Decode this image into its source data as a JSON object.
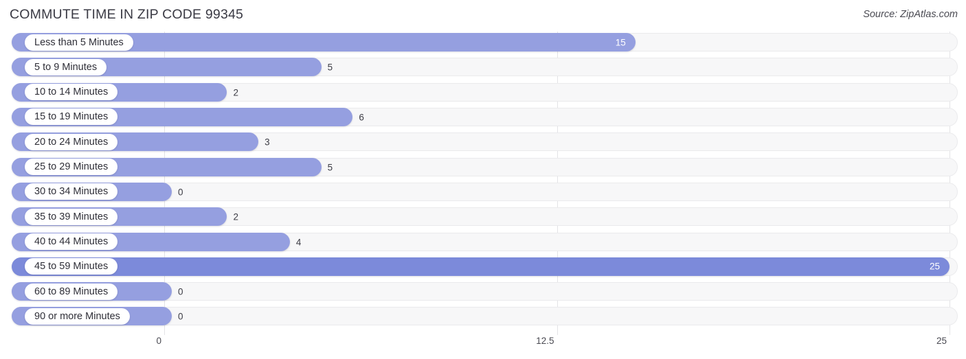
{
  "header": {
    "title": "COMMUTE TIME IN ZIP CODE 99345",
    "source": "Source: ZipAtlas.com"
  },
  "chart_data": {
    "type": "bar",
    "orientation": "horizontal",
    "title": "COMMUTE TIME IN ZIP CODE 99345",
    "xlabel": "",
    "ylabel": "",
    "xlim": [
      0,
      25
    ],
    "grid": true,
    "legend": false,
    "source": "Source: ZipAtlas.com",
    "tick_labels": [
      "0",
      "12.5",
      "25"
    ],
    "tick_values": [
      0,
      12.5,
      25
    ],
    "categories": [
      "Less than 5 Minutes",
      "5 to 9 Minutes",
      "10 to 14 Minutes",
      "15 to 19 Minutes",
      "20 to 24 Minutes",
      "25 to 29 Minutes",
      "30 to 34 Minutes",
      "35 to 39 Minutes",
      "40 to 44 Minutes",
      "45 to 59 Minutes",
      "60 to 89 Minutes",
      "90 or more Minutes"
    ],
    "values": [
      15,
      5,
      2,
      6,
      3,
      5,
      0,
      2,
      4,
      25,
      0,
      0
    ],
    "value_labels": [
      "15",
      "5",
      "2",
      "6",
      "3",
      "5",
      "0",
      "2",
      "4",
      "25",
      "0",
      "0"
    ],
    "colors": {
      "bar": "#959fe0",
      "bar_max": "#7c8ada",
      "track": "#f7f7f8",
      "gridline": "#e3e3e6",
      "text": "#3c3c45"
    }
  },
  "rows": [
    {
      "label": "Less than 5 Minutes",
      "value": 15,
      "value_label": "15",
      "inside": true
    },
    {
      "label": "5 to 9 Minutes",
      "value": 5,
      "value_label": "5",
      "inside": false
    },
    {
      "label": "10 to 14 Minutes",
      "value": 2,
      "value_label": "2",
      "inside": false
    },
    {
      "label": "15 to 19 Minutes",
      "value": 6,
      "value_label": "6",
      "inside": false
    },
    {
      "label": "20 to 24 Minutes",
      "value": 3,
      "value_label": "3",
      "inside": false
    },
    {
      "label": "25 to 29 Minutes",
      "value": 5,
      "value_label": "5",
      "inside": false
    },
    {
      "label": "30 to 34 Minutes",
      "value": 0,
      "value_label": "0",
      "inside": false
    },
    {
      "label": "35 to 39 Minutes",
      "value": 2,
      "value_label": "2",
      "inside": false
    },
    {
      "label": "40 to 44 Minutes",
      "value": 4,
      "value_label": "4",
      "inside": false
    },
    {
      "label": "45 to 59 Minutes",
      "value": 25,
      "value_label": "25",
      "inside": true
    },
    {
      "label": "60 to 89 Minutes",
      "value": 0,
      "value_label": "0",
      "inside": false
    },
    {
      "label": "90 or more Minutes",
      "value": 0,
      "value_label": "0",
      "inside": false
    }
  ],
  "axis": {
    "ticks": [
      {
        "label": "0",
        "value": 0
      },
      {
        "label": "12.5",
        "value": 12.5
      },
      {
        "label": "25",
        "value": 25
      }
    ]
  }
}
